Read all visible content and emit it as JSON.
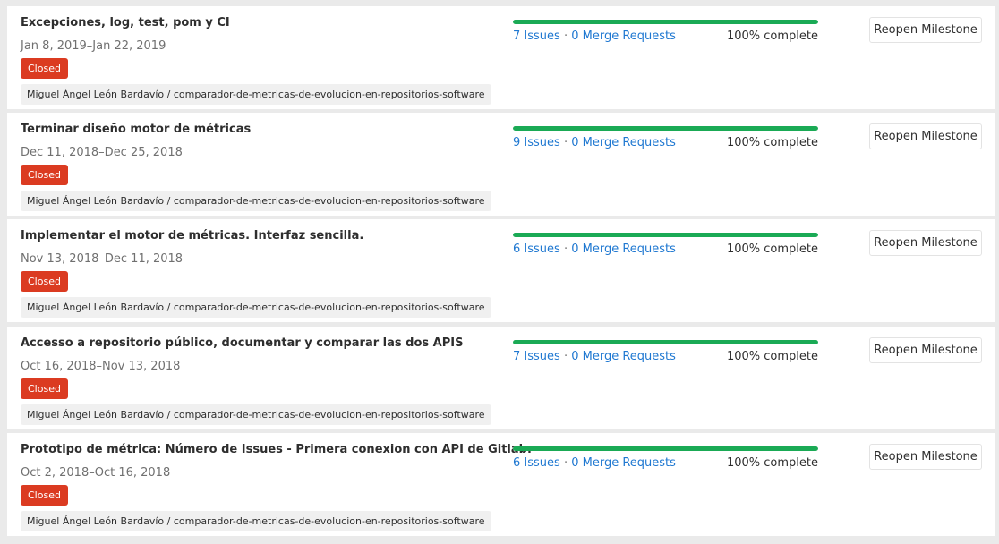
{
  "colors": {
    "closed_badge": "#db3b21",
    "progress_fill": "#1aaa55",
    "link": "#1f78d1",
    "page_bg": "#eaeaea"
  },
  "milestones": [
    {
      "title": "Excepciones, log, test, pom y CI",
      "dates": "Jan 8, 2019–Jan 22, 2019",
      "status": "Closed",
      "project": "Miguel Ángel León Bardavío / comparador-de-metricas-de-evolucion-en-repositorios-software",
      "issues": "7 Issues",
      "separator": "·",
      "merge_requests": "0 Merge Requests",
      "progress": 1.0,
      "percent_label": "100% complete",
      "action_label": "Reopen Milestone"
    },
    {
      "title": "Terminar diseño motor de métricas",
      "dates": "Dec 11, 2018–Dec 25, 2018",
      "status": "Closed",
      "project": "Miguel Ángel León Bardavío / comparador-de-metricas-de-evolucion-en-repositorios-software",
      "issues": "9 Issues",
      "separator": "·",
      "merge_requests": "0 Merge Requests",
      "progress": 1.0,
      "percent_label": "100% complete",
      "action_label": "Reopen Milestone"
    },
    {
      "title": "Implementar el motor de métricas. Interfaz sencilla.",
      "dates": "Nov 13, 2018–Dec 11, 2018",
      "status": "Closed",
      "project": "Miguel Ángel León Bardavío / comparador-de-metricas-de-evolucion-en-repositorios-software",
      "issues": "6 Issues",
      "separator": "·",
      "merge_requests": "0 Merge Requests",
      "progress": 1.0,
      "percent_label": "100% complete",
      "action_label": "Reopen Milestone"
    },
    {
      "title": "Accesso a repositorio público, documentar y comparar las dos APIS",
      "dates": "Oct 16, 2018–Nov 13, 2018",
      "status": "Closed",
      "project": "Miguel Ángel León Bardavío / comparador-de-metricas-de-evolucion-en-repositorios-software",
      "issues": "7 Issues",
      "separator": "·",
      "merge_requests": "0 Merge Requests",
      "progress": 1.0,
      "percent_label": "100% complete",
      "action_label": "Reopen Milestone"
    },
    {
      "title": "Prototipo de métrica: Número de Issues - Primera conexion con API de Gitlab.",
      "dates": "Oct 2, 2018–Oct 16, 2018",
      "status": "Closed",
      "project": "Miguel Ángel León Bardavío / comparador-de-metricas-de-evolucion-en-repositorios-software",
      "issues": "6 Issues",
      "separator": "·",
      "merge_requests": "0 Merge Requests",
      "progress": 1.0,
      "percent_label": "100% complete",
      "action_label": "Reopen Milestone"
    }
  ]
}
